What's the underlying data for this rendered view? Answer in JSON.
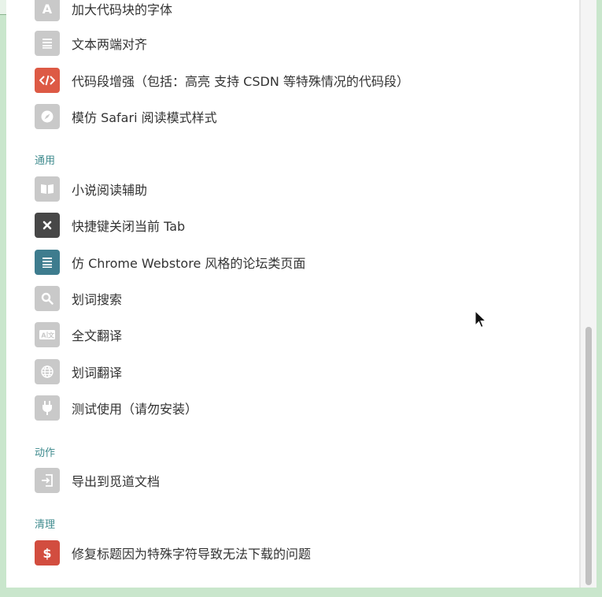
{
  "colors": {
    "gray_icon": "#c9c9c9",
    "dark_icon": "#474747",
    "teal_icon": "#3e7c8e",
    "red_icon": "#dd5a45",
    "section_text": "#3f8b8e"
  },
  "items_top": [
    {
      "label": "加大代码块的字体",
      "icon": "letter-a-icon"
    },
    {
      "label": "文本两端对齐",
      "icon": "align-justify-icon"
    },
    {
      "label": "代码段增强（包括：高亮 支持 CSDN 等特殊情况的代码段）",
      "icon": "code-icon"
    },
    {
      "label": "模仿 Safari 阅读模式样式",
      "icon": "compass-icon"
    }
  ],
  "sections": {
    "general": "通用",
    "actions": "动作",
    "cleanup": "清理"
  },
  "items_general": [
    {
      "label": "小说阅读辅助",
      "icon": "book-icon"
    },
    {
      "label": "快捷键关闭当前 Tab",
      "icon": "close-icon"
    },
    {
      "label": "仿 Chrome Webstore 风格的论坛类页面",
      "icon": "list-icon"
    },
    {
      "label": "划词搜索",
      "icon": "search-icon"
    },
    {
      "label": "全文翻译",
      "icon": "translate-icon"
    },
    {
      "label": "划词翻译",
      "icon": "globe-icon"
    },
    {
      "label": "测试使用（请勿安装）",
      "icon": "plug-icon"
    }
  ],
  "items_actions": [
    {
      "label": "导出到觅道文档",
      "icon": "export-icon"
    }
  ],
  "items_cleanup": [
    {
      "label": "修复标题因为特殊字符导致无法下载的问题",
      "icon": "dollar-icon"
    }
  ]
}
